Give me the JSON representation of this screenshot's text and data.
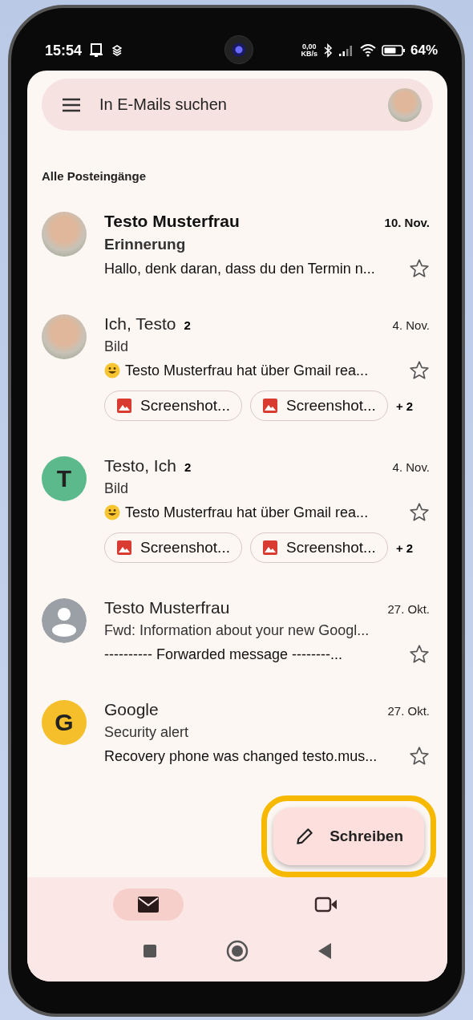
{
  "status_bar": {
    "time": "15:54",
    "net_speed": "0,00",
    "net_unit": "KB/s",
    "battery": "64%"
  },
  "search": {
    "placeholder": "In E-Mails suchen"
  },
  "section_title": "Alle Posteingänge",
  "emails": [
    {
      "kind": "photo",
      "sender": "Testo Musterfrau",
      "date": "10. Nov.",
      "subject": "Erinnerung",
      "snippet": "Hallo, denk daran, dass du den Termin n...",
      "unread": true,
      "starred": false
    },
    {
      "kind": "photo",
      "sender": "Ich, Testo",
      "count": "2",
      "date": "4. Nov.",
      "subject": "Bild",
      "snippet": "Testo Musterfrau hat über Gmail rea...",
      "smiley": true,
      "unread": false,
      "starred": false,
      "attachments": [
        "Screenshot...",
        "Screenshot..."
      ],
      "more": "+ 2"
    },
    {
      "kind": "letter",
      "letter": "T",
      "color": "#5bb98b",
      "sender": "Testo, Ich",
      "count": "2",
      "date": "4. Nov.",
      "subject": "Bild",
      "snippet": "Testo Musterfrau hat über Gmail rea...",
      "smiley": true,
      "unread": false,
      "starred": false,
      "attachments": [
        "Screenshot...",
        "Screenshot..."
      ],
      "more": "+ 2"
    },
    {
      "kind": "person",
      "color": "#9aa0a6",
      "sender": "Testo Musterfrau",
      "date": "27. Okt.",
      "subject": "Fwd: Information about your new Googl...",
      "snippet": "---------- Forwarded message --------...",
      "unread": false,
      "starred": false
    },
    {
      "kind": "letter",
      "letter": "G",
      "color": "#f4bf2a",
      "sender": "Google",
      "date": "27. Okt.",
      "subject": "Security alert",
      "snippet": "Recovery phone was changed testo.mus...",
      "unread": false,
      "starred": false
    }
  ],
  "compose": {
    "label": "Schreiben",
    "highlighted": true
  },
  "bottom_nav": [
    {
      "kind": "mail",
      "selected": true
    },
    {
      "kind": "video",
      "selected": false
    }
  ]
}
